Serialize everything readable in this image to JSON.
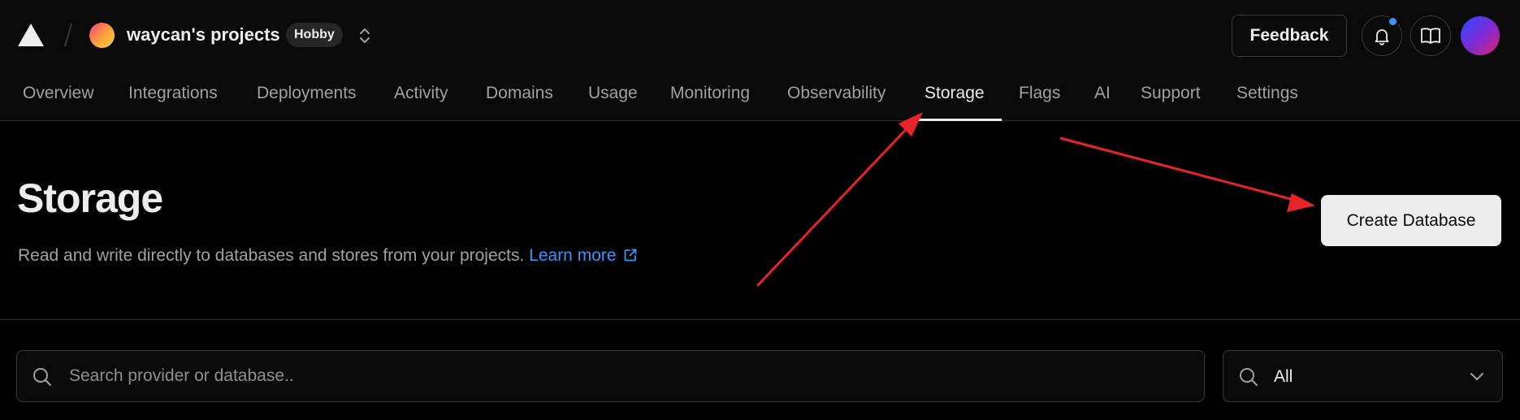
{
  "header": {
    "team_name": "waycan's projects",
    "plan_badge": "Hobby",
    "feedback_label": "Feedback",
    "icons": [
      "vercel-logo-icon",
      "slash-divider-icon",
      "chevron-up-down-icon",
      "bell-icon",
      "book-icon"
    ]
  },
  "nav": {
    "tabs": [
      {
        "label": "Overview"
      },
      {
        "label": "Integrations"
      },
      {
        "label": "Deployments"
      },
      {
        "label": "Activity"
      },
      {
        "label": "Domains"
      },
      {
        "label": "Usage"
      },
      {
        "label": "Monitoring"
      },
      {
        "label": "Observability"
      },
      {
        "label": "Storage",
        "active": true
      },
      {
        "label": "Flags"
      },
      {
        "label": "AI"
      },
      {
        "label": "Support"
      },
      {
        "label": "Settings"
      }
    ]
  },
  "main": {
    "title": "Storage",
    "description": "Read and write directly to databases and stores from your projects.",
    "learn_more": "Learn more",
    "create_button": "Create Database"
  },
  "search": {
    "placeholder": "Search provider or database..",
    "value": ""
  },
  "filter": {
    "selected": "All"
  },
  "colors": {
    "background": "#000000",
    "accent_link": "#3b95f4",
    "notification_dot": "#3b95f4",
    "annotation_arrow": "#e8232a"
  }
}
